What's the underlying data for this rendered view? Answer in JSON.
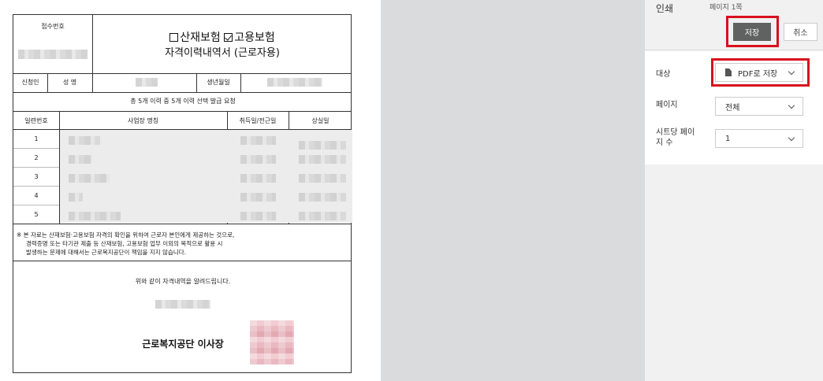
{
  "document": {
    "receipt_label": "접수번호",
    "insurance_industrial": "산재보험",
    "insurance_employment": "고용보험",
    "doc_title": "자격이력내역서 (근로자용)",
    "applicant_label": "신청인",
    "name_label": "성 명",
    "birth_label": "생년월일",
    "summary": "총 5개 이력 중 5개 이력 선택 발급 요청",
    "table_headers": [
      "일련번호",
      "사업장 명칭",
      "취득일/전근일",
      "상실일"
    ],
    "rows": [
      "1",
      "2",
      "3",
      "4",
      "5"
    ],
    "note_line1": "※ 본 자료는 산재보험·고용보험 자격의 확인을 위하여 근로자 본인에게 제공하는 것으로,",
    "note_line2": "경력증명 또는 타기관 제출 등 산재보험, 고용보험 업무 이외의 목적으로 활용 시",
    "note_line3": "발생하는 문제에 대해서는 근로복지공단이 책임을 지지 않습니다.",
    "notice": "위와 같이 자격내역을 알려드립니다.",
    "issuer": "근로복지공단  이사장"
  },
  "print_panel": {
    "title": "인쇄",
    "page_count": "페이지 1쪽",
    "save_label": "저장",
    "cancel_label": "취소",
    "destination_label": "대상",
    "destination_value": "PDF로 저장",
    "pages_label": "페이지",
    "pages_value": "전체",
    "pages_per_sheet_label": "시트당 페이\n지 수",
    "pages_per_sheet_value": "1"
  },
  "colors": {
    "highlight": "#d8111d",
    "save_button": "#606161",
    "preview_background": "#dadbdc"
  }
}
